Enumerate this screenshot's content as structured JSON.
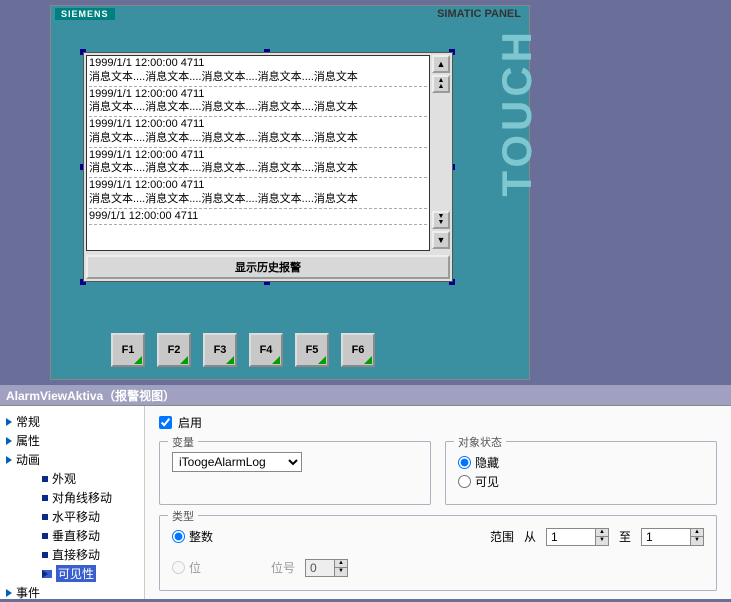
{
  "panel": {
    "brand": "SIEMENS",
    "title": "SIMATIC PANEL",
    "touch": "TOUCH",
    "history_button": "显示历史报警",
    "fkeys": [
      "F1",
      "F2",
      "F3",
      "F4",
      "F5",
      "F6"
    ],
    "alarm_entries": [
      {
        "ts": "1999/1/1 12:00:00 4711",
        "msg": "消息文本....消息文本....消息文本....消息文本....消息文本"
      },
      {
        "ts": "1999/1/1 12:00:00 4711",
        "msg": "消息文本....消息文本....消息文本....消息文本....消息文本"
      },
      {
        "ts": "1999/1/1 12:00:00 4711",
        "msg": "消息文本....消息文本....消息文本....消息文本....消息文本"
      },
      {
        "ts": "1999/1/1 12:00:00 4711",
        "msg": "消息文本....消息文本....消息文本....消息文本....消息文本"
      },
      {
        "ts": "1999/1/1 12:00:00 4711",
        "msg": "消息文本....消息文本....消息文本....消息文本....消息文本"
      },
      {
        "ts": "999/1/1 12:00:00 4711",
        "msg": ""
      }
    ]
  },
  "prop": {
    "header": "AlarmViewAktiva（报警视图）",
    "enable": "启用",
    "tree": {
      "general": "常规",
      "attributes": "属性",
      "animation": "动画",
      "appearance": "外观",
      "diagonal": "对角线移动",
      "horizontal": "水平移动",
      "vertical": "垂直移动",
      "direct": "直接移动",
      "visibility": "可见性",
      "events": "事件"
    },
    "variable": {
      "title": "变量",
      "value": "iToogeAlarmLog"
    },
    "obj_state": {
      "title": "对象状态",
      "hidden": "隐藏",
      "visible": "可见"
    },
    "type": {
      "title": "类型",
      "integer": "整数",
      "bit": "位",
      "bitno": "位号",
      "bitno_val": "0",
      "range": "范围",
      "from": "从",
      "from_val": "1",
      "to": "至",
      "to_val": "1"
    }
  }
}
